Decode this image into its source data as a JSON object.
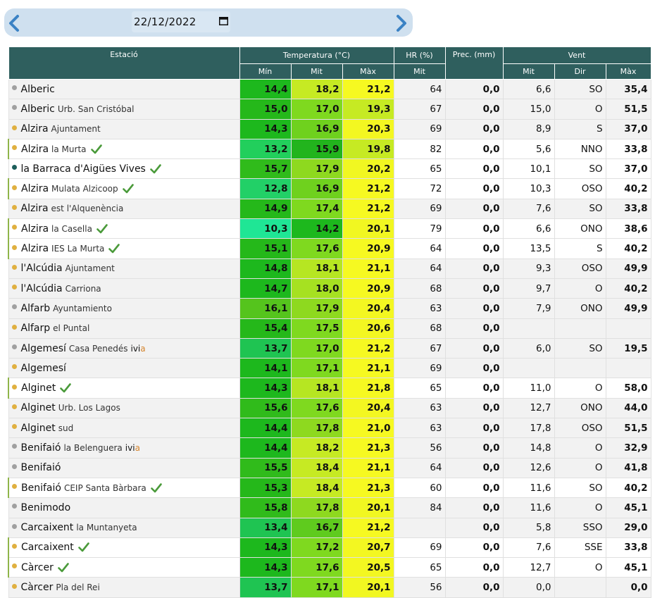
{
  "nav": {
    "date": "22/12/2022",
    "prev_label": "previous-day",
    "next_label": "next-day"
  },
  "headers": {
    "estacio": "Estació",
    "temperatura": "Temperatura (°C)",
    "hr": "HR (%)",
    "prec": "Prec. (mm)",
    "vent": "Vent",
    "min": "Mín",
    "mit": "Mit",
    "max": "Màx",
    "hr_mit": "Mit",
    "vent_mit": "Mit",
    "vent_dir": "Dir",
    "vent_max": "Màx"
  },
  "colors": {
    "header_bg": "#2f5f5e",
    "dot_grey": "#a0a0a0",
    "dot_orange": "#e0b040",
    "dot_teal": "#1c5e5a",
    "check": "#4a9a3a"
  },
  "rows": [
    {
      "name": "Alberic",
      "sub": "",
      "dot": "grey",
      "check": false,
      "ivia": false,
      "marked": false,
      "white": false,
      "min": "14,4",
      "mit": "18,2",
      "max": "21,2",
      "hr": "64",
      "prec": "0,0",
      "vmit": "6,6",
      "dir": "SO",
      "vmax": "35,4",
      "cmin": "#1db81d",
      "cmit": "#c6ea23",
      "cmax": "#f6f921"
    },
    {
      "name": "Alberic",
      "sub": "Urb. San Cristóbal",
      "dot": "grey",
      "check": false,
      "ivia": false,
      "marked": false,
      "white": false,
      "min": "15,0",
      "mit": "17,0",
      "max": "19,3",
      "hr": "67",
      "prec": "0,0",
      "vmit": "15,0",
      "dir": "O",
      "vmax": "51,5",
      "cmin": "#25b81a",
      "cmit": "#7fd91f",
      "cmax": "#c6ea23"
    },
    {
      "name": "Alzira",
      "sub": "Ajuntament",
      "dot": "orange",
      "check": false,
      "ivia": false,
      "marked": false,
      "white": false,
      "min": "14,3",
      "mit": "16,9",
      "max": "20,3",
      "hr": "69",
      "prec": "0,0",
      "vmit": "8,9",
      "dir": "S",
      "vmax": "37,0",
      "cmin": "#1db81d",
      "cmit": "#6fd11e",
      "cmax": "#f3f721"
    },
    {
      "name": "Alzira",
      "sub": "la Murta",
      "dot": "orange",
      "check": true,
      "ivia": false,
      "marked": true,
      "white": true,
      "min": "13,2",
      "mit": "15,9",
      "max": "19,8",
      "hr": "82",
      "prec": "0,0",
      "vmit": "5,6",
      "dir": "NNO",
      "vmax": "33,8",
      "cmin": "#22cf5c",
      "cmit": "#22b41d",
      "cmax": "#c6ea23"
    },
    {
      "name": "la Barraca d'Aigües Vives",
      "sub": "",
      "dot": "teal",
      "check": true,
      "ivia": false,
      "marked": false,
      "white": true,
      "min": "15,7",
      "mit": "17,9",
      "max": "20,2",
      "hr": "65",
      "prec": "0,0",
      "vmit": "10,1",
      "dir": "SO",
      "vmax": "37,0",
      "cmin": "#30bb1b",
      "cmit": "#8ed91f",
      "cmax": "#f1f721"
    },
    {
      "name": "Alzira",
      "sub": "Mulata Alzicoop",
      "dot": "orange",
      "check": true,
      "ivia": false,
      "marked": true,
      "white": true,
      "min": "12,8",
      "mit": "16,9",
      "max": "21,2",
      "hr": "72",
      "prec": "0,0",
      "vmit": "10,3",
      "dir": "OSO",
      "vmax": "40,2",
      "cmin": "#22d067",
      "cmit": "#6fd11e",
      "cmax": "#f6f921"
    },
    {
      "name": "Alzira",
      "sub": "est l'Alquenència",
      "dot": "orange",
      "check": false,
      "ivia": false,
      "marked": false,
      "white": false,
      "min": "14,9",
      "mit": "17,4",
      "max": "21,2",
      "hr": "69",
      "prec": "0,0",
      "vmit": "7,6",
      "dir": "SO",
      "vmax": "33,8",
      "cmin": "#25b81a",
      "cmit": "#7fd91f",
      "cmax": "#f6f921"
    },
    {
      "name": "Alzira",
      "sub": "la Casella",
      "dot": "orange",
      "check": true,
      "ivia": false,
      "marked": true,
      "white": true,
      "min": "10,3",
      "mit": "14,2",
      "max": "20,1",
      "hr": "79",
      "prec": "0,0",
      "vmit": "6,6",
      "dir": "ONO",
      "vmax": "38,6",
      "cmin": "#1fe695",
      "cmit": "#1db81d",
      "cmax": "#f1f721"
    },
    {
      "name": "Alzira",
      "sub": "IES La Murta",
      "dot": "orange",
      "check": true,
      "ivia": false,
      "marked": true,
      "white": true,
      "min": "15,1",
      "mit": "17,6",
      "max": "20,9",
      "hr": "64",
      "prec": "0,0",
      "vmit": "13,5",
      "dir": "S",
      "vmax": "40,2",
      "cmin": "#25b81a",
      "cmit": "#7fd91f",
      "cmax": "#f6f921"
    },
    {
      "name": "l'Alcúdia",
      "sub": "Ajuntament",
      "dot": "orange",
      "check": false,
      "ivia": false,
      "marked": false,
      "white": false,
      "min": "14,8",
      "mit": "18,1",
      "max": "21,1",
      "hr": "64",
      "prec": "0,0",
      "vmit": "9,3",
      "dir": "OSO",
      "vmax": "49,9",
      "cmin": "#1db81d",
      "cmit": "#b6e622",
      "cmax": "#f6f921"
    },
    {
      "name": "l'Alcúdia",
      "sub": "Carriona",
      "dot": "orange",
      "check": false,
      "ivia": false,
      "marked": false,
      "white": false,
      "min": "14,7",
      "mit": "18,0",
      "max": "20,9",
      "hr": "68",
      "prec": "0,0",
      "vmit": "9,7",
      "dir": "O",
      "vmax": "40,2",
      "cmin": "#1db81d",
      "cmit": "#a6e121",
      "cmax": "#f6f921"
    },
    {
      "name": "Alfarb",
      "sub": "Ayuntamiento",
      "dot": "grey",
      "check": false,
      "ivia": false,
      "marked": false,
      "white": false,
      "min": "16,1",
      "mit": "17,9",
      "max": "20,4",
      "hr": "63",
      "prec": "0,0",
      "vmit": "7,9",
      "dir": "ONO",
      "vmax": "49,9",
      "cmin": "#55c41d",
      "cmit": "#8ed91f",
      "cmax": "#f3f721"
    },
    {
      "name": "Alfarp",
      "sub": "el Puntal",
      "dot": "orange",
      "check": false,
      "ivia": false,
      "marked": false,
      "white": false,
      "min": "15,4",
      "mit": "17,5",
      "max": "20,6",
      "hr": "68",
      "prec": "0,0",
      "vmit": "",
      "dir": "",
      "vmax": "",
      "cmin": "#25b81a",
      "cmit": "#7fd91f",
      "cmax": "#f3f721"
    },
    {
      "name": "Algemesí",
      "sub": "Casa Penedés",
      "dot": "grey",
      "check": false,
      "ivia": true,
      "marked": false,
      "white": false,
      "min": "13,7",
      "mit": "17,0",
      "max": "21,2",
      "hr": "67",
      "prec": "0,0",
      "vmit": "6,0",
      "dir": "SO",
      "vmax": "19,5",
      "cmin": "#1fc452",
      "cmit": "#7fd91f",
      "cmax": "#f6f921"
    },
    {
      "name": "Algemesí",
      "sub": "",
      "dot": "orange",
      "check": false,
      "ivia": false,
      "marked": false,
      "white": false,
      "min": "14,1",
      "mit": "17,1",
      "max": "21,1",
      "hr": "69",
      "prec": "0,0",
      "vmit": "",
      "dir": "",
      "vmax": "",
      "cmin": "#1db81d",
      "cmit": "#7fd91f",
      "cmax": "#f6f921"
    },
    {
      "name": "Alginet",
      "sub": "",
      "dot": "orange",
      "check": true,
      "ivia": false,
      "marked": true,
      "white": true,
      "min": "14,3",
      "mit": "18,1",
      "max": "21,8",
      "hr": "65",
      "prec": "0,0",
      "vmit": "11,0",
      "dir": "O",
      "vmax": "58,0",
      "cmin": "#1db81d",
      "cmit": "#b6e622",
      "cmax": "#f6f921"
    },
    {
      "name": "Alginet",
      "sub": "Urb. Los Lagos",
      "dot": "orange",
      "check": false,
      "ivia": false,
      "marked": false,
      "white": false,
      "min": "15,6",
      "mit": "17,6",
      "max": "20,4",
      "hr": "63",
      "prec": "0,0",
      "vmit": "12,7",
      "dir": "ONO",
      "vmax": "44,0",
      "cmin": "#30bb1b",
      "cmit": "#7fd91f",
      "cmax": "#f3f721"
    },
    {
      "name": "Alginet",
      "sub": "sud",
      "dot": "orange",
      "check": false,
      "ivia": false,
      "marked": false,
      "white": false,
      "min": "14,4",
      "mit": "17,8",
      "max": "21,0",
      "hr": "63",
      "prec": "0,0",
      "vmit": "17,8",
      "dir": "OSO",
      "vmax": "51,5",
      "cmin": "#1db81d",
      "cmit": "#8ed91f",
      "cmax": "#f6f921"
    },
    {
      "name": "Benifaió",
      "sub": "la Belenguera",
      "dot": "grey",
      "check": false,
      "ivia": true,
      "marked": false,
      "white": false,
      "min": "14,4",
      "mit": "18,2",
      "max": "21,3",
      "hr": "56",
      "prec": "0,0",
      "vmit": "14,8",
      "dir": "O",
      "vmax": "32,9",
      "cmin": "#1db81d",
      "cmit": "#c6ea23",
      "cmax": "#f6f921"
    },
    {
      "name": "Benifaió",
      "sub": "",
      "dot": "grey",
      "check": false,
      "ivia": false,
      "marked": false,
      "white": false,
      "min": "15,5",
      "mit": "18,4",
      "max": "21,1",
      "hr": "64",
      "prec": "0,0",
      "vmit": "12,6",
      "dir": "O",
      "vmax": "41,8",
      "cmin": "#30bb1b",
      "cmit": "#c6ea23",
      "cmax": "#f6f921"
    },
    {
      "name": "Benifaió",
      "sub": "CEIP Santa Bàrbara",
      "dot": "orange",
      "check": true,
      "ivia": false,
      "marked": true,
      "white": true,
      "min": "15,3",
      "mit": "18,4",
      "max": "21,3",
      "hr": "60",
      "prec": "0,0",
      "vmit": "11,6",
      "dir": "SO",
      "vmax": "40,2",
      "cmin": "#25b81a",
      "cmit": "#c6ea23",
      "cmax": "#f6f921"
    },
    {
      "name": "Benimodo",
      "sub": "",
      "dot": "grey",
      "check": false,
      "ivia": false,
      "marked": false,
      "white": false,
      "min": "15,8",
      "mit": "17,8",
      "max": "20,1",
      "hr": "84",
      "prec": "0,0",
      "vmit": "11,6",
      "dir": "O",
      "vmax": "45,1",
      "cmin": "#30bb1b",
      "cmit": "#8ed91f",
      "cmax": "#f1f721"
    },
    {
      "name": "Carcaixent",
      "sub": "la Muntanyeta",
      "dot": "grey",
      "check": false,
      "ivia": false,
      "marked": false,
      "white": false,
      "min": "13,4",
      "mit": "16,7",
      "max": "21,2",
      "hr": "",
      "prec": "0,0",
      "vmit": "5,8",
      "dir": "SSO",
      "vmax": "29,0",
      "cmin": "#1fc452",
      "cmit": "#5fcb1e",
      "cmax": "#f6f921"
    },
    {
      "name": "Carcaixent",
      "sub": "",
      "dot": "orange",
      "check": true,
      "ivia": false,
      "marked": true,
      "white": true,
      "min": "14,3",
      "mit": "17,2",
      "max": "20,7",
      "hr": "69",
      "prec": "0,0",
      "vmit": "7,6",
      "dir": "SSE",
      "vmax": "33,8",
      "cmin": "#1db81d",
      "cmit": "#7fd91f",
      "cmax": "#f3f721"
    },
    {
      "name": "Càrcer",
      "sub": "",
      "dot": "orange",
      "check": true,
      "ivia": false,
      "marked": true,
      "white": true,
      "min": "14,3",
      "mit": "17,6",
      "max": "20,5",
      "hr": "65",
      "prec": "0,0",
      "vmit": "12,7",
      "dir": "O",
      "vmax": "45,1",
      "cmin": "#1db81d",
      "cmit": "#7fd91f",
      "cmax": "#f3f721"
    },
    {
      "name": "Càrcer",
      "sub": "Pla del Rei",
      "dot": "orange",
      "check": false,
      "ivia": false,
      "marked": false,
      "white": false,
      "min": "13,7",
      "mit": "17,1",
      "max": "20,1",
      "hr": "56",
      "prec": "0,0",
      "vmit": "0,0",
      "dir": "",
      "vmax": "0,0",
      "cmin": "#1fc452",
      "cmit": "#7fd91f",
      "cmax": "#f1f721"
    }
  ]
}
